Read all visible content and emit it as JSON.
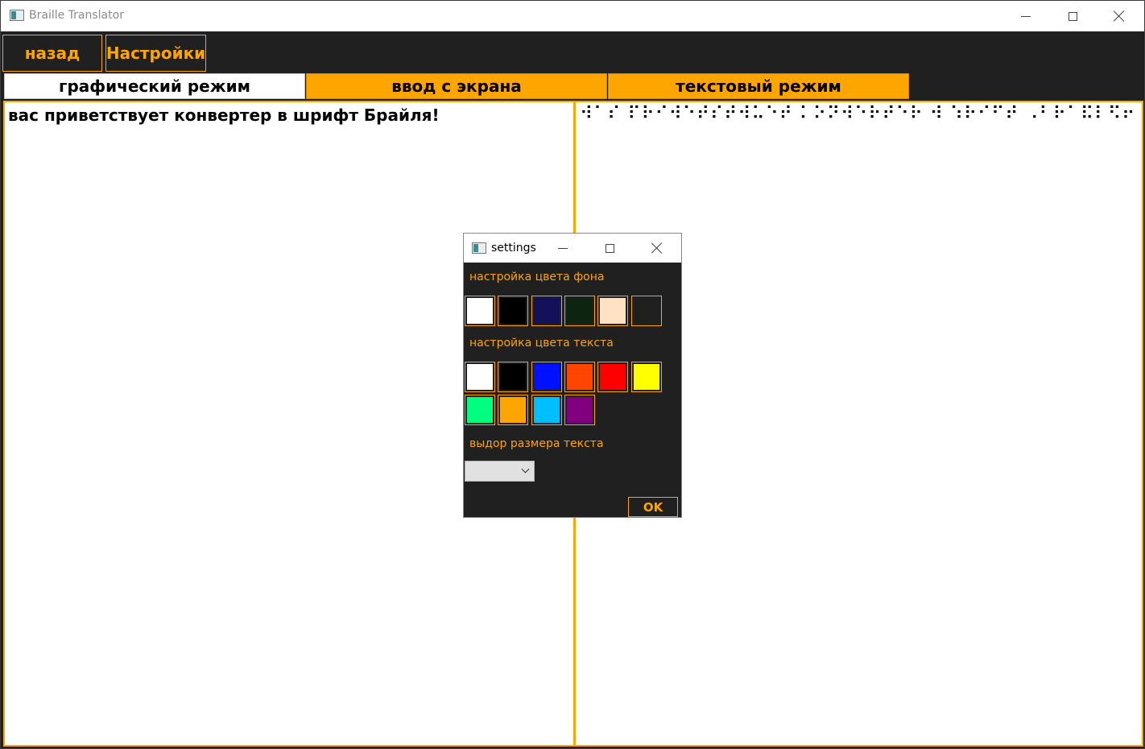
{
  "window": {
    "title": "Braille Translator"
  },
  "toolbar": {
    "back_label": "назад",
    "settings_label": "Настройки"
  },
  "tabs": [
    {
      "label": "графический режим",
      "active": true
    },
    {
      "label": "ввод с экрана",
      "active": false
    },
    {
      "label": "текстовый режим",
      "active": false
    }
  ],
  "content": {
    "input_text": "вас приветствует конвертер в шрифт Брайля!",
    "braille_text": "⠺⠁⠎ ⠏⠗⠊⠺⠑⠞⠎⠞⠺⠥⠑⠞ ⠅⠕⠝⠺⠑⠗⠞⠑⠗ ⠺ ⠱⠗⠊⠋⠞ ⠠⠃⠗⠁⠯⠇⠫⠖"
  },
  "dialog": {
    "title": "settings",
    "bg_label": "настройка цвета фона",
    "text_label": "настройка цвета текста",
    "size_label": "выдор размера текста",
    "size_value": "",
    "ok_label": "OK",
    "bg_colors": [
      "#ffffff",
      "#000000",
      "#15105a",
      "#0c2410",
      "#ffe2c4",
      "#202020"
    ],
    "text_colors": [
      "#ffffff",
      "#000000",
      "#0011ff",
      "#ff4500",
      "#ff0000",
      "#ffff00",
      "#00ff7f",
      "#ffa500",
      "#00bfff",
      "#800080"
    ]
  },
  "theme": {
    "accent": "#ffa500",
    "background": "#202020"
  }
}
